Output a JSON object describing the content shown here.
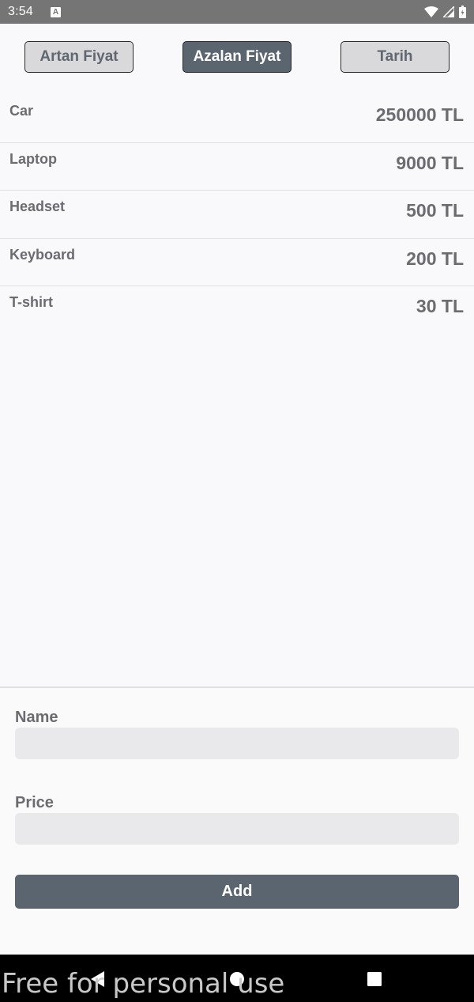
{
  "status_bar": {
    "time": "3:54",
    "notification_icon": "A"
  },
  "sort_buttons": [
    {
      "label": "Artan Fiyat",
      "active": false
    },
    {
      "label": "Azalan Fiyat",
      "active": true
    },
    {
      "label": "Tarih",
      "active": false
    }
  ],
  "products": [
    {
      "name": "Car",
      "price": "250000 TL"
    },
    {
      "name": "Laptop",
      "price": "9000 TL"
    },
    {
      "name": "Headset",
      "price": "500 TL"
    },
    {
      "name": "Keyboard",
      "price": "200 TL"
    },
    {
      "name": "T-shirt",
      "price": "30 TL"
    }
  ],
  "form": {
    "name_label": "Name",
    "name_value": "",
    "price_label": "Price",
    "price_value": "",
    "add_label": "Add"
  },
  "watermark": "Free for personal use",
  "colors": {
    "accent": "#5b6570",
    "inactive_button": "#d9d9dc",
    "background": "#f9f8fb",
    "text": "#6c6c70"
  }
}
